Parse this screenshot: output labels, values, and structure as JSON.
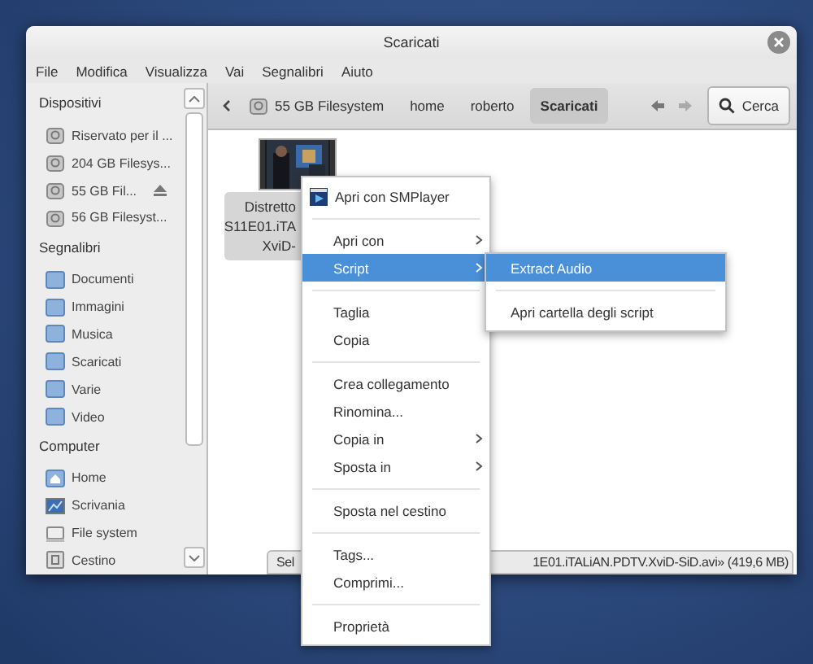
{
  "window": {
    "title": "Scaricati"
  },
  "menu": [
    "File",
    "Modifica",
    "Visualizza",
    "Vai",
    "Segnalibri",
    "Aiuto"
  ],
  "sidebar": {
    "sections": [
      {
        "title": "Dispositivi",
        "items": [
          {
            "label": "Riservato per il ...",
            "kind": "drive",
            "eject": false
          },
          {
            "label": "204 GB Filesys...",
            "kind": "drive",
            "eject": false
          },
          {
            "label": "55 GB Fil...",
            "kind": "drive",
            "eject": true
          },
          {
            "label": "56 GB Filesyst...",
            "kind": "drive",
            "eject": false
          }
        ]
      },
      {
        "title": "Segnalibri",
        "items": [
          {
            "label": "Documenti",
            "kind": "folder",
            "eject": false
          },
          {
            "label": "Immagini",
            "kind": "folder",
            "eject": false
          },
          {
            "label": "Musica",
            "kind": "folder",
            "eject": false
          },
          {
            "label": "Scaricati",
            "kind": "folder",
            "eject": false
          },
          {
            "label": "Varie",
            "kind": "folder",
            "eject": false
          },
          {
            "label": "Video",
            "kind": "folder",
            "eject": false
          }
        ]
      },
      {
        "title": "Computer",
        "items": [
          {
            "label": "Home",
            "kind": "home",
            "eject": false
          },
          {
            "label": "Scrivania",
            "kind": "desktop",
            "eject": false
          },
          {
            "label": "File system",
            "kind": "filesystem",
            "eject": false
          },
          {
            "label": "Cestino",
            "kind": "trash",
            "eject": false
          }
        ]
      }
    ]
  },
  "pathbar": {
    "crumbs": [
      {
        "label": "55 GB Filesystem",
        "kind": "drive",
        "selected": false
      },
      {
        "label": "home",
        "kind": "plain",
        "selected": false
      },
      {
        "label": "roberto",
        "kind": "plain",
        "selected": false
      },
      {
        "label": "Scaricati",
        "kind": "plain",
        "selected": true
      }
    ],
    "search": "Cerca"
  },
  "files": [
    {
      "lines": [
        "Distretto",
        "S11E01.iTA",
        "XviD-"
      ],
      "selected": true
    }
  ],
  "status_bar": {
    "left": "Sel",
    "right": "1E01.iTALiAN.PDTV.XviD-SiD.avi» (419,6 MB)"
  },
  "context_menu": [
    {
      "kind": "app",
      "label": "Apri con SMPlayer",
      "selected": false
    },
    {
      "kind": "separator"
    },
    {
      "kind": "submenu",
      "label": "Apri con",
      "selected": false
    },
    {
      "kind": "submenu",
      "label": "Script",
      "selected": true
    },
    {
      "kind": "separator"
    },
    {
      "kind": "item",
      "label": "Taglia",
      "selected": false
    },
    {
      "kind": "item",
      "label": "Copia",
      "selected": false
    },
    {
      "kind": "separator"
    },
    {
      "kind": "item",
      "label": "Crea collegamento",
      "selected": false
    },
    {
      "kind": "item",
      "label": "Rinomina...",
      "selected": false
    },
    {
      "kind": "submenu",
      "label": "Copia in",
      "selected": false
    },
    {
      "kind": "submenu",
      "label": "Sposta in",
      "selected": false
    },
    {
      "kind": "separator"
    },
    {
      "kind": "item",
      "label": "Sposta nel cestino",
      "selected": false
    },
    {
      "kind": "separator"
    },
    {
      "kind": "item",
      "label": "Tags...",
      "selected": false
    },
    {
      "kind": "item",
      "label": "Comprimi...",
      "selected": false
    },
    {
      "kind": "separator"
    },
    {
      "kind": "item",
      "label": "Proprietà",
      "selected": false
    }
  ],
  "submenu": [
    {
      "kind": "item",
      "label": "Extract Audio",
      "selected": true
    },
    {
      "kind": "separator"
    },
    {
      "kind": "item",
      "label": "Apri cartella degli script",
      "selected": false
    }
  ]
}
